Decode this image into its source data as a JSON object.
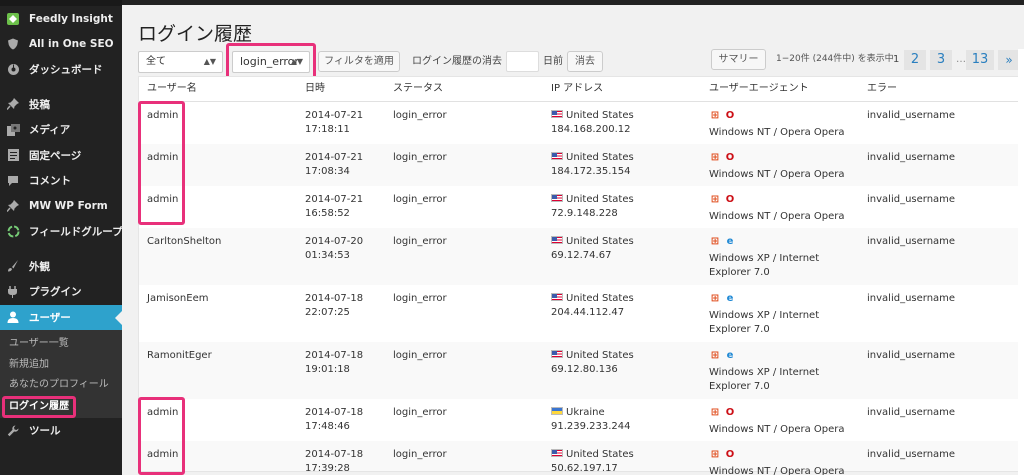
{
  "sidebar": {
    "items": [
      {
        "label": "Feedly Insight",
        "icon": "feedly-icon"
      },
      {
        "label": "All in One SEO",
        "icon": "seo-shield-icon"
      },
      {
        "label": "ダッシュボード",
        "icon": "dashboard-icon"
      },
      {
        "label": "投稿",
        "icon": "pin-icon"
      },
      {
        "label": "メディア",
        "icon": "media-icon"
      },
      {
        "label": "固定ページ",
        "icon": "page-icon"
      },
      {
        "label": "コメント",
        "icon": "comment-icon"
      },
      {
        "label": "MW WP Form",
        "icon": "pin-icon"
      },
      {
        "label": "フィールドグループ",
        "icon": "recycle-icon"
      },
      {
        "label": "外観",
        "icon": "brush-icon"
      },
      {
        "label": "プラグイン",
        "icon": "plugin-icon"
      },
      {
        "label": "ユーザー",
        "icon": "user-icon"
      },
      {
        "label": "ツール",
        "icon": "wrench-icon"
      }
    ],
    "submenu": [
      {
        "label": "ユーザー一覧"
      },
      {
        "label": "新規追加"
      },
      {
        "label": "あなたのプロフィール"
      },
      {
        "label": "ログイン履歴"
      }
    ]
  },
  "page": {
    "title": "ログイン履歴"
  },
  "toolbar": {
    "filter_all": "全て",
    "filter_status": "login_error",
    "apply_button": "フィルタを適用",
    "delete_label": "ログイン履歴の消去",
    "days_suffix": "日前",
    "delete_button": "消去",
    "summary_button": "サマリー",
    "count_text": "1−20件 (244件中) を表示中",
    "current_page": "1",
    "pages": [
      "2",
      "3"
    ],
    "ellipsis": "…",
    "last_page": "13",
    "next": "»"
  },
  "table": {
    "headers": {
      "user": "ユーザー名",
      "date": "日時",
      "status": "ステータス",
      "ip": "IP アドレス",
      "ua": "ユーザーエージェント",
      "error": "エラー"
    },
    "rows": [
      {
        "user": "admin",
        "date": "2014-07-21",
        "time": "17:18:11",
        "status": "login_error",
        "country": "United States",
        "flag": "us",
        "ip": "184.168.200.12",
        "browser_icon": "opera-icon",
        "ua": "Windows NT / Opera Opera",
        "error": "invalid_username"
      },
      {
        "user": "admin",
        "date": "2014-07-21",
        "time": "17:08:34",
        "status": "login_error",
        "country": "United States",
        "flag": "us",
        "ip": "184.172.35.154",
        "browser_icon": "opera-icon",
        "ua": "Windows NT / Opera Opera",
        "error": "invalid_username"
      },
      {
        "user": "admin",
        "date": "2014-07-21",
        "time": "16:58:52",
        "status": "login_error",
        "country": "United States",
        "flag": "us",
        "ip": "72.9.148.228",
        "browser_icon": "opera-icon",
        "ua": "Windows NT / Opera Opera",
        "error": "invalid_username"
      },
      {
        "user": "CarltonShelton",
        "date": "2014-07-20",
        "time": "01:34:53",
        "status": "login_error",
        "country": "United States",
        "flag": "us",
        "ip": "69.12.74.67",
        "browser_icon": "ie-icon",
        "ua": "Windows XP / Internet Explorer 7.0",
        "error": "invalid_username"
      },
      {
        "user": "JamisonEem",
        "date": "2014-07-18",
        "time": "22:07:25",
        "status": "login_error",
        "country": "United States",
        "flag": "us",
        "ip": "204.44.112.47",
        "browser_icon": "ie-icon",
        "ua": "Windows XP / Internet Explorer 7.0",
        "error": "invalid_username"
      },
      {
        "user": "RamonitEger",
        "date": "2014-07-18",
        "time": "19:01:18",
        "status": "login_error",
        "country": "United States",
        "flag": "us",
        "ip": "69.12.80.136",
        "browser_icon": "ie-icon",
        "ua": "Windows XP / Internet Explorer 7.0",
        "error": "invalid_username"
      },
      {
        "user": "admin",
        "date": "2014-07-18",
        "time": "17:48:46",
        "status": "login_error",
        "country": "Ukraine",
        "flag": "ua",
        "ip": "91.239.233.244",
        "browser_icon": "opera-icon",
        "ua": "Windows NT / Opera Opera",
        "error": "invalid_username"
      },
      {
        "user": "admin",
        "date": "2014-07-18",
        "time": "17:39:28",
        "status": "login_error",
        "country": "United States",
        "flag": "us",
        "ip": "50.62.197.17",
        "browser_icon": "opera-icon",
        "ua": "Windows NT / Opera Opera",
        "error": "invalid_username"
      }
    ]
  },
  "colors": {
    "highlight": "#e8307a",
    "sidebar_bg": "#222222",
    "active_menu": "#2ea2cc",
    "link": "#2a7fbf"
  }
}
